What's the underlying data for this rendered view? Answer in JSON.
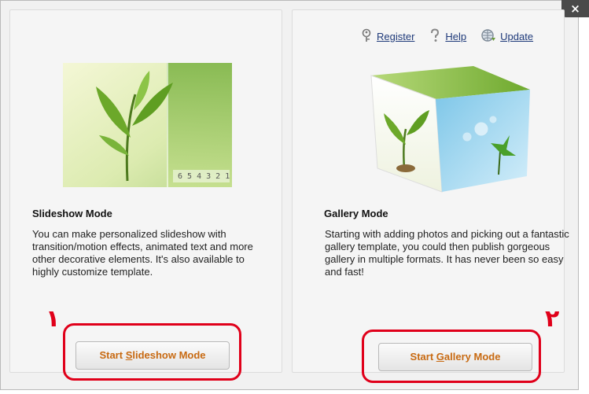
{
  "window": {
    "close_label": "×"
  },
  "toplinks": {
    "register": "Register",
    "help": "Help",
    "update": "Update",
    "icons": [
      "key-icon",
      "help-question-icon",
      "update-globe-icon"
    ]
  },
  "left": {
    "title": "Slideshow Mode",
    "description": "You can make personalized slideshow with transition/motion effects, animated text and more other decorative elements. It's also available to highly customize template.",
    "button_prefix": "Start ",
    "button_access": "S",
    "button_rest": "lideshow Mode",
    "thumb_numbers": "6 5 4 3 2 1",
    "annotation": "١"
  },
  "right": {
    "title": "Gallery Mode",
    "description": "Starting with adding photos and picking out a fantastic gallery template, you could then publish gorgeous gallery in multiple formats. It has never been so easy and fast!",
    "button_prefix": "Start ",
    "button_access": "G",
    "button_rest": "allery Mode",
    "annotation": "٢"
  },
  "colors": {
    "accent": "#c86a12",
    "annotation": "#e0001a",
    "link": "#1f3a7a"
  }
}
